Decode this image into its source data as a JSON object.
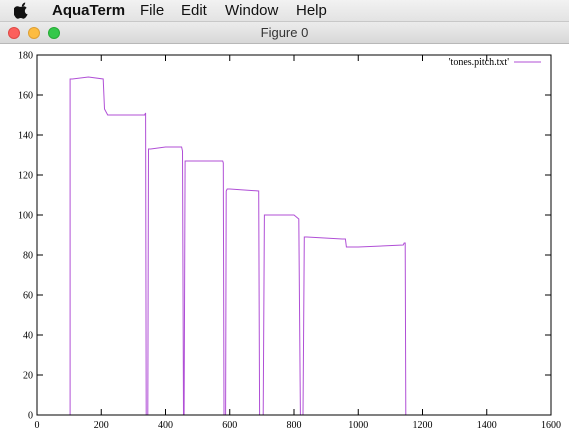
{
  "menubar": {
    "apple_icon": "apple-logo-icon",
    "app_name": "AquaTerm",
    "items": [
      "File",
      "Edit",
      "Window",
      "Help"
    ]
  },
  "window": {
    "title": "Figure 0",
    "controls": [
      "close",
      "minimize",
      "zoom"
    ]
  },
  "chart_data": {
    "type": "line",
    "title": "",
    "xlabel": "",
    "ylabel": "",
    "xlim": [
      0,
      1600
    ],
    "ylim": [
      0,
      180
    ],
    "x_ticks": [
      0,
      200,
      400,
      600,
      800,
      1000,
      1200,
      1400,
      1600
    ],
    "y_ticks": [
      0,
      20,
      40,
      60,
      80,
      100,
      120,
      140,
      160,
      180
    ],
    "grid": false,
    "legend_position": "top-right",
    "line_color": "#b04fd6",
    "series": [
      {
        "name": "'tones.pitch.txt'",
        "x": [
          0,
          103,
          103,
          110,
          160,
          206,
          210,
          220,
          335,
          338,
          340,
          345,
          347,
          354,
          400,
          450,
          453,
          456,
          458,
          461,
          464,
          500,
          578,
          580,
          582,
          585,
          587,
          589,
          592,
          595,
          600,
          690,
          693,
          696,
          699,
          704,
          708,
          712,
          720,
          800,
          815,
          820,
          824,
          828,
          832,
          836,
          840,
          950,
          960,
          963,
          968,
          1000,
          1140,
          1143,
          1146,
          1148,
          1150,
          1600
        ],
        "y": [
          0,
          0,
          168,
          168,
          169,
          168,
          153,
          150,
          150,
          151,
          0,
          0,
          133,
          133,
          134,
          134,
          132,
          0,
          0,
          127,
          127,
          127,
          127,
          126,
          0,
          0,
          0,
          112,
          113,
          113,
          113,
          112,
          0,
          0,
          0,
          0,
          100,
          100,
          100,
          100,
          98,
          0,
          0,
          0,
          89,
          89,
          89,
          88,
          88,
          84,
          84,
          84,
          85,
          86,
          86,
          0,
          0,
          0
        ]
      }
    ]
  }
}
